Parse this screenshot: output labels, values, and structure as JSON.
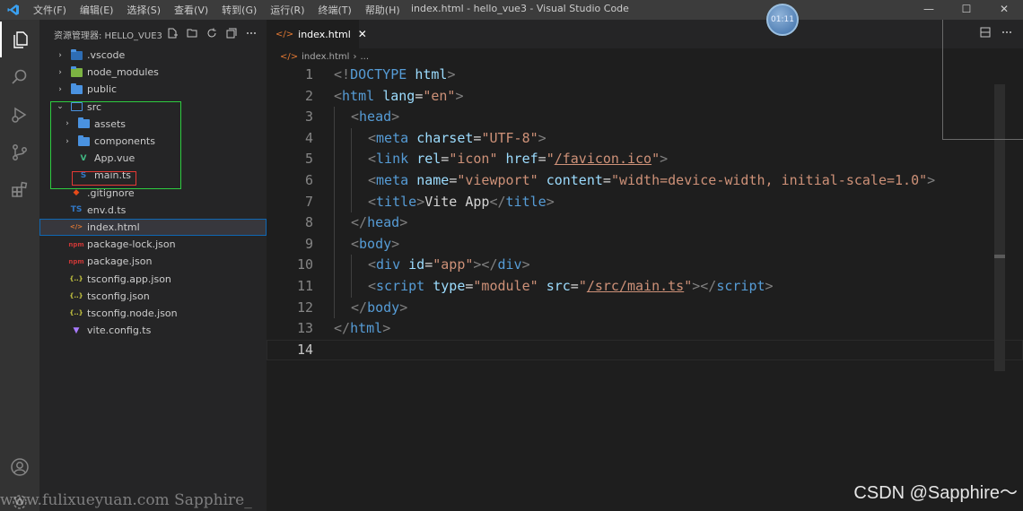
{
  "titlebar": {
    "menu": [
      "文件(F)",
      "编辑(E)",
      "选择(S)",
      "查看(V)",
      "转到(G)",
      "运行(R)",
      "终端(T)",
      "帮助(H)"
    ],
    "title": "index.html - hello_vue3 - Visual Studio Code",
    "clock": "01:11",
    "controls": [
      "—",
      "☐",
      "✕"
    ]
  },
  "activitybar": {
    "items": [
      "explorer-icon",
      "search-icon",
      "run-debug-icon",
      "source-control-icon",
      "extensions-icon"
    ],
    "bottom": [
      "account-icon",
      "settings-gear-icon"
    ]
  },
  "sidebar": {
    "header": "资源管理器: HELLO_VUE3",
    "tree": [
      {
        "label": ".vscode",
        "type": "folder",
        "indent": 0,
        "chevron": "›",
        "color": "#2e6db4"
      },
      {
        "label": "node_modules",
        "type": "folder",
        "indent": 0,
        "chevron": "›",
        "color": "#7cb342"
      },
      {
        "label": "public",
        "type": "folder",
        "indent": 0,
        "chevron": "›",
        "color": "#4a92e0"
      },
      {
        "label": "src",
        "type": "folder-open",
        "indent": 0,
        "chevron": "⌄",
        "color": "#4a92e0"
      },
      {
        "label": "assets",
        "type": "folder",
        "indent": 1,
        "chevron": "›",
        "color": "#4a92e0"
      },
      {
        "label": "components",
        "type": "folder",
        "indent": 1,
        "chevron": "›",
        "color": "#4a92e0"
      },
      {
        "label": "App.vue",
        "type": "vue",
        "indent": 1,
        "chevron": "",
        "icon_text": "V",
        "color": "#41b883"
      },
      {
        "label": "main.ts",
        "type": "ts",
        "indent": 1,
        "chevron": "",
        "icon_text": "S",
        "color": "#3178c6"
      },
      {
        "label": ".gitignore",
        "type": "git",
        "indent": 0,
        "chevron": "",
        "icon_text": "◆",
        "color": "#e64a19"
      },
      {
        "label": "env.d.ts",
        "type": "ts",
        "indent": 0,
        "chevron": "",
        "icon_text": "TS",
        "color": "#3178c6"
      },
      {
        "label": "index.html",
        "type": "html",
        "indent": 0,
        "chevron": "",
        "icon_text": "</>",
        "color": "#e37933",
        "selected": true
      },
      {
        "label": "package-lock.json",
        "type": "npm",
        "indent": 0,
        "chevron": "",
        "icon_text": "npm",
        "color": "#cb3837"
      },
      {
        "label": "package.json",
        "type": "npm",
        "indent": 0,
        "chevron": "",
        "icon_text": "npm",
        "color": "#cb3837"
      },
      {
        "label": "tsconfig.app.json",
        "type": "json",
        "indent": 0,
        "chevron": "",
        "icon_text": "{..}",
        "color": "#cbcb41"
      },
      {
        "label": "tsconfig.json",
        "type": "json",
        "indent": 0,
        "chevron": "",
        "icon_text": "{..}",
        "color": "#cbcb41"
      },
      {
        "label": "tsconfig.node.json",
        "type": "json",
        "indent": 0,
        "chevron": "",
        "icon_text": "{..}",
        "color": "#cbcb41"
      },
      {
        "label": "vite.config.ts",
        "type": "vite",
        "indent": 0,
        "chevron": "",
        "icon_text": "▼",
        "color": "#a97bff"
      }
    ]
  },
  "editor": {
    "tab": {
      "icon": "</>",
      "label": "index.html",
      "close": "✕"
    },
    "breadcrumb": {
      "icon": "</>",
      "file": "index.html",
      "sep": "›",
      "rest": "..."
    },
    "current_line": 14,
    "lines": [
      {
        "n": 1,
        "indent": 0,
        "tokens": [
          [
            "punc",
            "<!"
          ],
          [
            "tag",
            "DOCTYPE"
          ],
          [
            "text",
            " "
          ],
          [
            "attr",
            "html"
          ],
          [
            "punc",
            ">"
          ]
        ]
      },
      {
        "n": 2,
        "indent": 0,
        "tokens": [
          [
            "punc",
            "<"
          ],
          [
            "tag",
            "html"
          ],
          [
            "text",
            " "
          ],
          [
            "attr",
            "lang"
          ],
          [
            "text",
            "="
          ],
          [
            "str",
            "\"en\""
          ],
          [
            "punc",
            ">"
          ]
        ]
      },
      {
        "n": 3,
        "indent": 1,
        "tokens": [
          [
            "punc",
            "<"
          ],
          [
            "tag",
            "head"
          ],
          [
            "punc",
            ">"
          ]
        ]
      },
      {
        "n": 4,
        "indent": 2,
        "tokens": [
          [
            "punc",
            "<"
          ],
          [
            "tag",
            "meta"
          ],
          [
            "text",
            " "
          ],
          [
            "attr",
            "charset"
          ],
          [
            "text",
            "="
          ],
          [
            "str",
            "\"UTF-8\""
          ],
          [
            "punc",
            ">"
          ]
        ]
      },
      {
        "n": 5,
        "indent": 2,
        "tokens": [
          [
            "punc",
            "<"
          ],
          [
            "tag",
            "link"
          ],
          [
            "text",
            " "
          ],
          [
            "attr",
            "rel"
          ],
          [
            "text",
            "="
          ],
          [
            "str",
            "\"icon\""
          ],
          [
            "text",
            " "
          ],
          [
            "attr",
            "href"
          ],
          [
            "text",
            "="
          ],
          [
            "str",
            "\""
          ],
          [
            "stru",
            "/favicon.ico"
          ],
          [
            "str",
            "\""
          ],
          [
            "punc",
            ">"
          ]
        ]
      },
      {
        "n": 6,
        "indent": 2,
        "tokens": [
          [
            "punc",
            "<"
          ],
          [
            "tag",
            "meta"
          ],
          [
            "text",
            " "
          ],
          [
            "attr",
            "name"
          ],
          [
            "text",
            "="
          ],
          [
            "str",
            "\"viewport\""
          ],
          [
            "text",
            " "
          ],
          [
            "attr",
            "content"
          ],
          [
            "text",
            "="
          ],
          [
            "str",
            "\"width=device-width, initial-scale=1.0\""
          ],
          [
            "punc",
            ">"
          ]
        ]
      },
      {
        "n": 7,
        "indent": 2,
        "tokens": [
          [
            "punc",
            "<"
          ],
          [
            "tag",
            "title"
          ],
          [
            "punc",
            ">"
          ],
          [
            "text",
            "Vite App"
          ],
          [
            "punc",
            "</"
          ],
          [
            "tag",
            "title"
          ],
          [
            "punc",
            ">"
          ]
        ]
      },
      {
        "n": 8,
        "indent": 1,
        "tokens": [
          [
            "punc",
            "</"
          ],
          [
            "tag",
            "head"
          ],
          [
            "punc",
            ">"
          ]
        ]
      },
      {
        "n": 9,
        "indent": 1,
        "tokens": [
          [
            "punc",
            "<"
          ],
          [
            "tag",
            "body"
          ],
          [
            "punc",
            ">"
          ]
        ]
      },
      {
        "n": 10,
        "indent": 2,
        "tokens": [
          [
            "punc",
            "<"
          ],
          [
            "tag",
            "div"
          ],
          [
            "text",
            " "
          ],
          [
            "attr",
            "id"
          ],
          [
            "text",
            "="
          ],
          [
            "str",
            "\"app\""
          ],
          [
            "punc",
            "></"
          ],
          [
            "tag",
            "div"
          ],
          [
            "punc",
            ">"
          ]
        ]
      },
      {
        "n": 11,
        "indent": 2,
        "tokens": [
          [
            "punc",
            "<"
          ],
          [
            "tag",
            "script"
          ],
          [
            "text",
            " "
          ],
          [
            "attr",
            "type"
          ],
          [
            "text",
            "="
          ],
          [
            "str",
            "\"module\""
          ],
          [
            "text",
            " "
          ],
          [
            "attr",
            "src"
          ],
          [
            "text",
            "="
          ],
          [
            "str",
            "\""
          ],
          [
            "stru",
            "/src/main.ts"
          ],
          [
            "str",
            "\""
          ],
          [
            "punc",
            "></"
          ],
          [
            "tag",
            "script"
          ],
          [
            "punc",
            ">"
          ]
        ]
      },
      {
        "n": 12,
        "indent": 1,
        "tokens": [
          [
            "punc",
            "</"
          ],
          [
            "tag",
            "body"
          ],
          [
            "punc",
            ">"
          ]
        ]
      },
      {
        "n": 13,
        "indent": 0,
        "tokens": [
          [
            "punc",
            "</"
          ],
          [
            "tag",
            "html"
          ],
          [
            "punc",
            ">"
          ]
        ]
      },
      {
        "n": 14,
        "indent": 0,
        "tokens": []
      }
    ]
  },
  "watermarks": {
    "left": "www.fulixueyuan.com Sapphire_",
    "right": "CSDN @Sapphire～"
  },
  "colors": {
    "annotation_green": "#2ecc40",
    "annotation_red": "#e53935",
    "accent": "#0f67b3"
  }
}
